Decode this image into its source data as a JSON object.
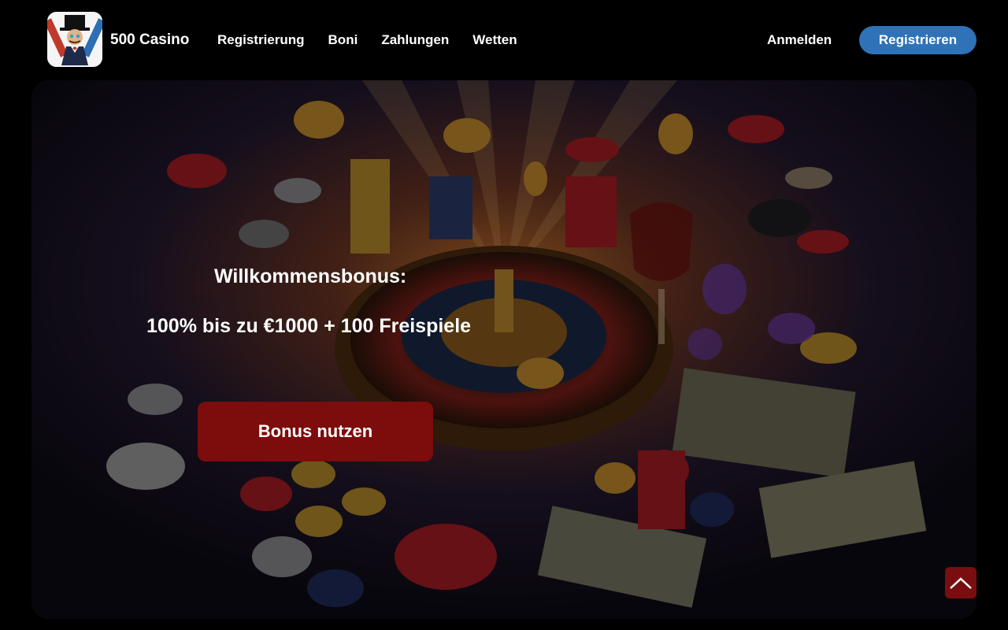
{
  "header": {
    "brand": "500 Casino",
    "nav": [
      "Registrierung",
      "Boni",
      "Zahlungen",
      "Wetten"
    ],
    "login_label": "Anmelden",
    "register_label": "Registrieren"
  },
  "hero": {
    "title": "Willkommensbonus:",
    "offer": "100% bis zu €1000 + 100 Freispiele",
    "cta_label": "Bonus nutzen"
  },
  "icons": {
    "logo": "casino-mascot-logo-icon",
    "scroll_top": "chevron-up-icon"
  },
  "colors": {
    "background": "#000000",
    "accent_blue": "#2f72b8",
    "cta_red": "#7d0c0c"
  }
}
